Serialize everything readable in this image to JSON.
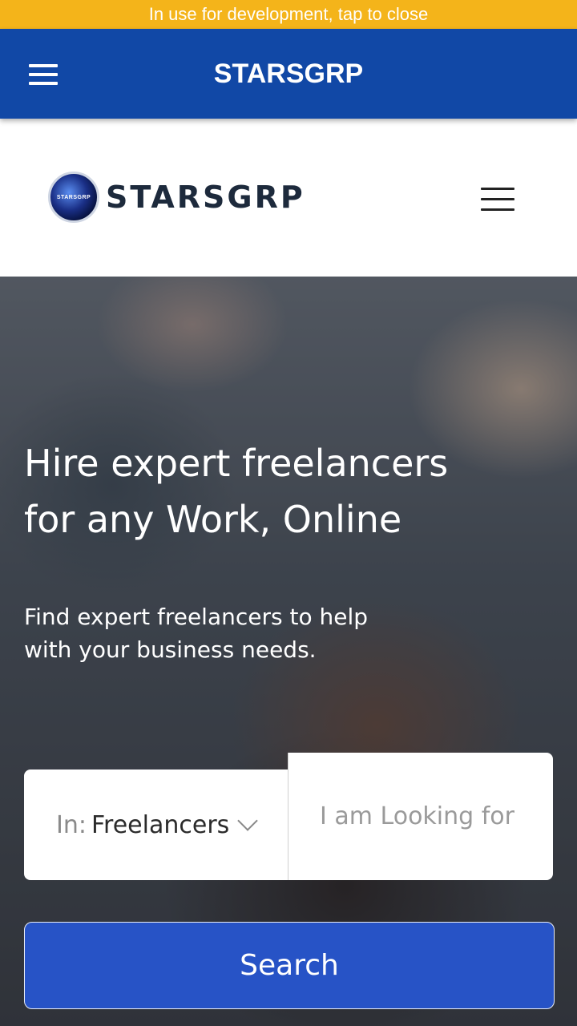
{
  "dev_banner": {
    "text": "In use for development, tap to close"
  },
  "appbar": {
    "title": "STARSGRP",
    "menu_icon": "hamburger-menu-icon",
    "color": "#1148a6"
  },
  "site_header": {
    "logo_text": "STARSGRP",
    "logo_badge_text": "STARSGRP",
    "menu_icon": "hamburger-menu-icon"
  },
  "hero": {
    "headline_line1": "Hire expert freelancers",
    "headline_line2": "for any Work, Online",
    "subline_line1": "Find expert freelancers to help",
    "subline_line2": "with your business needs.",
    "search": {
      "in_label": "In:",
      "category_value": "Freelancers",
      "category_icon": "chevron-down-icon",
      "query_placeholder": "I am Looking for",
      "button_label": "Search",
      "button_color": "#2753c6"
    }
  },
  "colors": {
    "dev_banner": "#f4b41a",
    "appbar": "#1148a6",
    "search_button": "#2753c6"
  }
}
